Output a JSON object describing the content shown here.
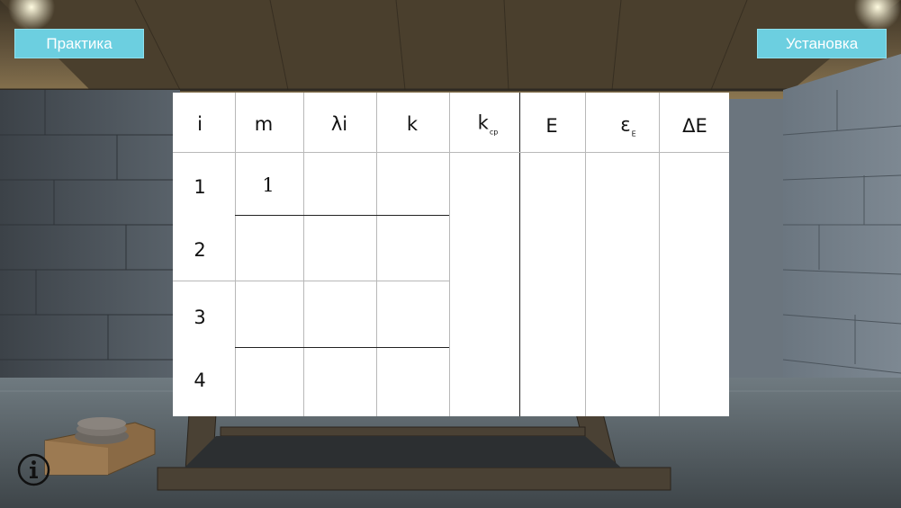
{
  "buttons": {
    "practice_label": "Практика",
    "setup_label": "Установка"
  },
  "table": {
    "headers": {
      "i": "i",
      "m": "m",
      "lambda": "λi",
      "k": "k",
      "kavg_main": "k",
      "kavg_sub": "ср",
      "E": "E",
      "eps_main": "ε",
      "eps_sub": "E",
      "dE": "ΔE"
    },
    "rows": [
      {
        "i": "1",
        "m": "1",
        "lambda": "",
        "k": ""
      },
      {
        "i": "2",
        "m": "",
        "lambda": "",
        "k": ""
      },
      {
        "i": "3",
        "m": "",
        "lambda": "",
        "k": ""
      },
      {
        "i": "4",
        "m": "",
        "lambda": "",
        "k": ""
      }
    ],
    "kavg": "",
    "E": "",
    "eps": "",
    "dE": ""
  },
  "icons": {
    "info": "info-icon"
  },
  "colors": {
    "button_bg": "#6ccfe0",
    "button_text": "#ffffff",
    "table_bg": "#ffffff"
  }
}
